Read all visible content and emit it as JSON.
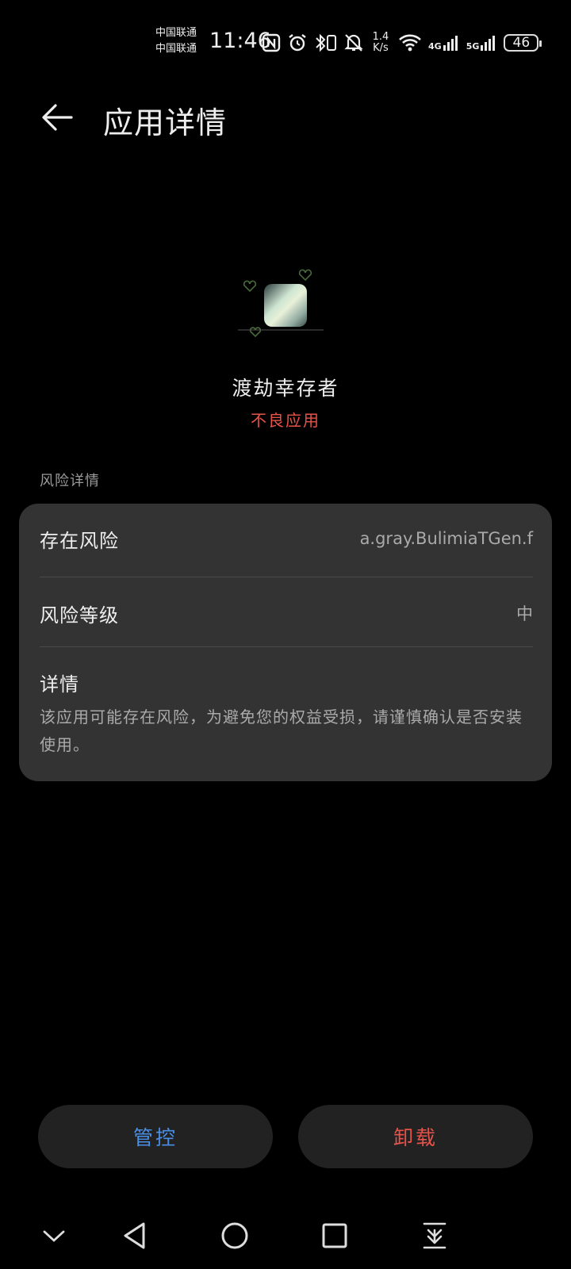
{
  "status_bar": {
    "carrier_1": "中国联通",
    "carrier_2": "中国联通",
    "time": "11:46",
    "net_speed_value": "1.4",
    "net_speed_unit": "K/s",
    "signal_1_label": "4G",
    "signal_2_label": "5G",
    "battery": "46",
    "icons": [
      "nfc-icon",
      "alarm-icon",
      "bluetooth-vibrate-icon",
      "mute-icon",
      "wifi-icon",
      "signal-icon",
      "battery-icon"
    ]
  },
  "header": {
    "title": "应用详情"
  },
  "app": {
    "name": "渡劫幸存者",
    "tag": "不良应用",
    "tag_color": "#e5534b"
  },
  "risk": {
    "section_title": "风险详情",
    "rows": [
      {
        "label": "存在风险",
        "value": "a.gray.BulimiaTGen.f"
      },
      {
        "label": "风险等级",
        "value": "中"
      }
    ],
    "detail_title": "详情",
    "detail_text": "该应用可能存在风险，为避免您的权益受损，请谨慎确认是否安装使用。"
  },
  "actions": {
    "manage_label": "管控",
    "manage_color": "#4a8fe6",
    "uninstall_label": "卸载",
    "uninstall_color": "#e5534b"
  },
  "nav": {
    "icons": [
      "chevron-down-icon",
      "back-triangle-icon",
      "home-circle-icon",
      "recents-square-icon",
      "download-icon"
    ]
  }
}
